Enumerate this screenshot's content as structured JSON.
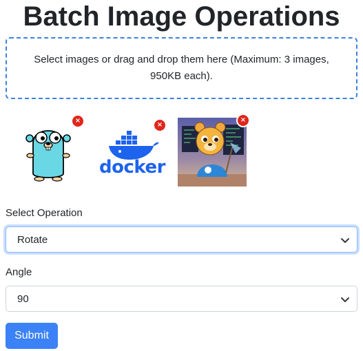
{
  "page": {
    "title": "Batch Image Operations"
  },
  "dropzone": {
    "text": "Select images or drag and drop them here (Maximum: 3 images, 950KB each)."
  },
  "images": [
    {
      "name": "gopher",
      "remove_label": "×"
    },
    {
      "name": "docker",
      "logo_text": "docker",
      "remove_label": "×"
    },
    {
      "name": "bear-developer",
      "remove_label": "×"
    }
  ],
  "operation": {
    "label": "Select Operation",
    "selected": "Rotate"
  },
  "angle": {
    "label": "Angle",
    "selected": "90"
  },
  "submit": {
    "label": "Submit"
  },
  "colors": {
    "accent": "#3b82f6",
    "dropzone_border": "#3b82dc",
    "remove_badge": "#e0261b",
    "docker_blue": "#1d63ed",
    "gopher_blue": "#6ad7e5"
  },
  "icons": [
    "close-icon",
    "chevron-down-icon"
  ]
}
